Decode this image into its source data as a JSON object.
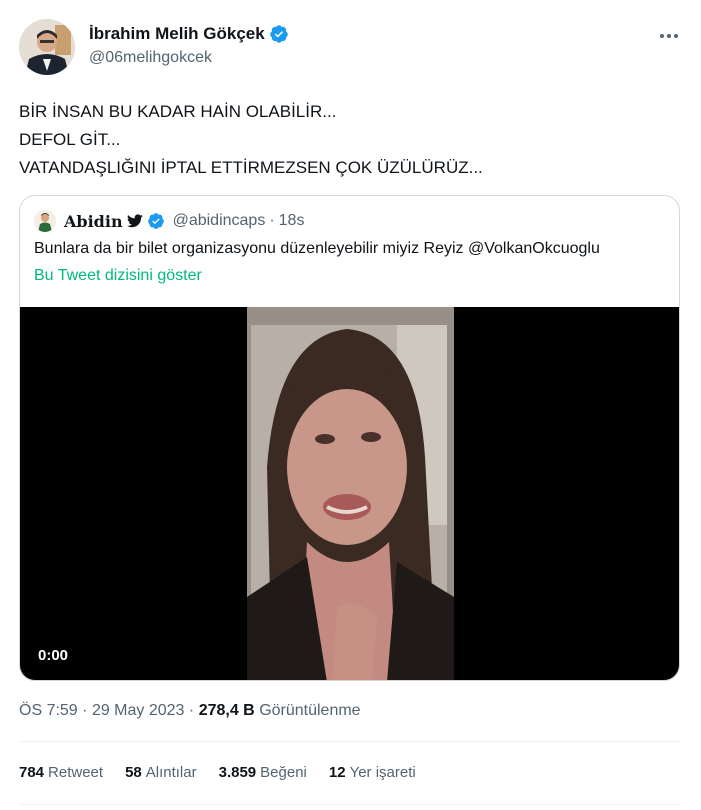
{
  "author": {
    "name": "İbrahim Melih Gökçek",
    "handle": "@06melihgokcek"
  },
  "tweet": {
    "lines": [
      "BİR İNSAN BU KADAR HAİN OLABİLİR...",
      "DEFOL GİT...",
      "VATANDAŞLIĞINI İPTAL ETTİRMEZSEN ÇOK ÜZÜLÜRÜZ..."
    ]
  },
  "quote": {
    "name": "Abidin",
    "handle": "@abidincaps",
    "separator": "·",
    "age": "18s",
    "text": "Bunlara da bir bilet organizasyonu düzenleyebilir miyiz Reyiz @VolkanOkcuoglu",
    "thread_link": "Bu Tweet dizisini göster",
    "video_time": "0:00"
  },
  "meta": {
    "time": "ÖS 7:59",
    "dot1": "·",
    "date": "29 May 2023",
    "dot2": "·",
    "views_value": "278,4 B",
    "views_label": "Görüntülenme"
  },
  "stats": [
    {
      "value": "784",
      "label": "Retweet"
    },
    {
      "value": "58",
      "label": "Alıntılar"
    },
    {
      "value": "3.859",
      "label": "Beğeni"
    },
    {
      "value": "12",
      "label": "Yer işareti"
    }
  ],
  "colors": {
    "accent_green": "#00ba7c",
    "verified_blue": "#1d9bf0",
    "secondary_text": "#536471"
  }
}
